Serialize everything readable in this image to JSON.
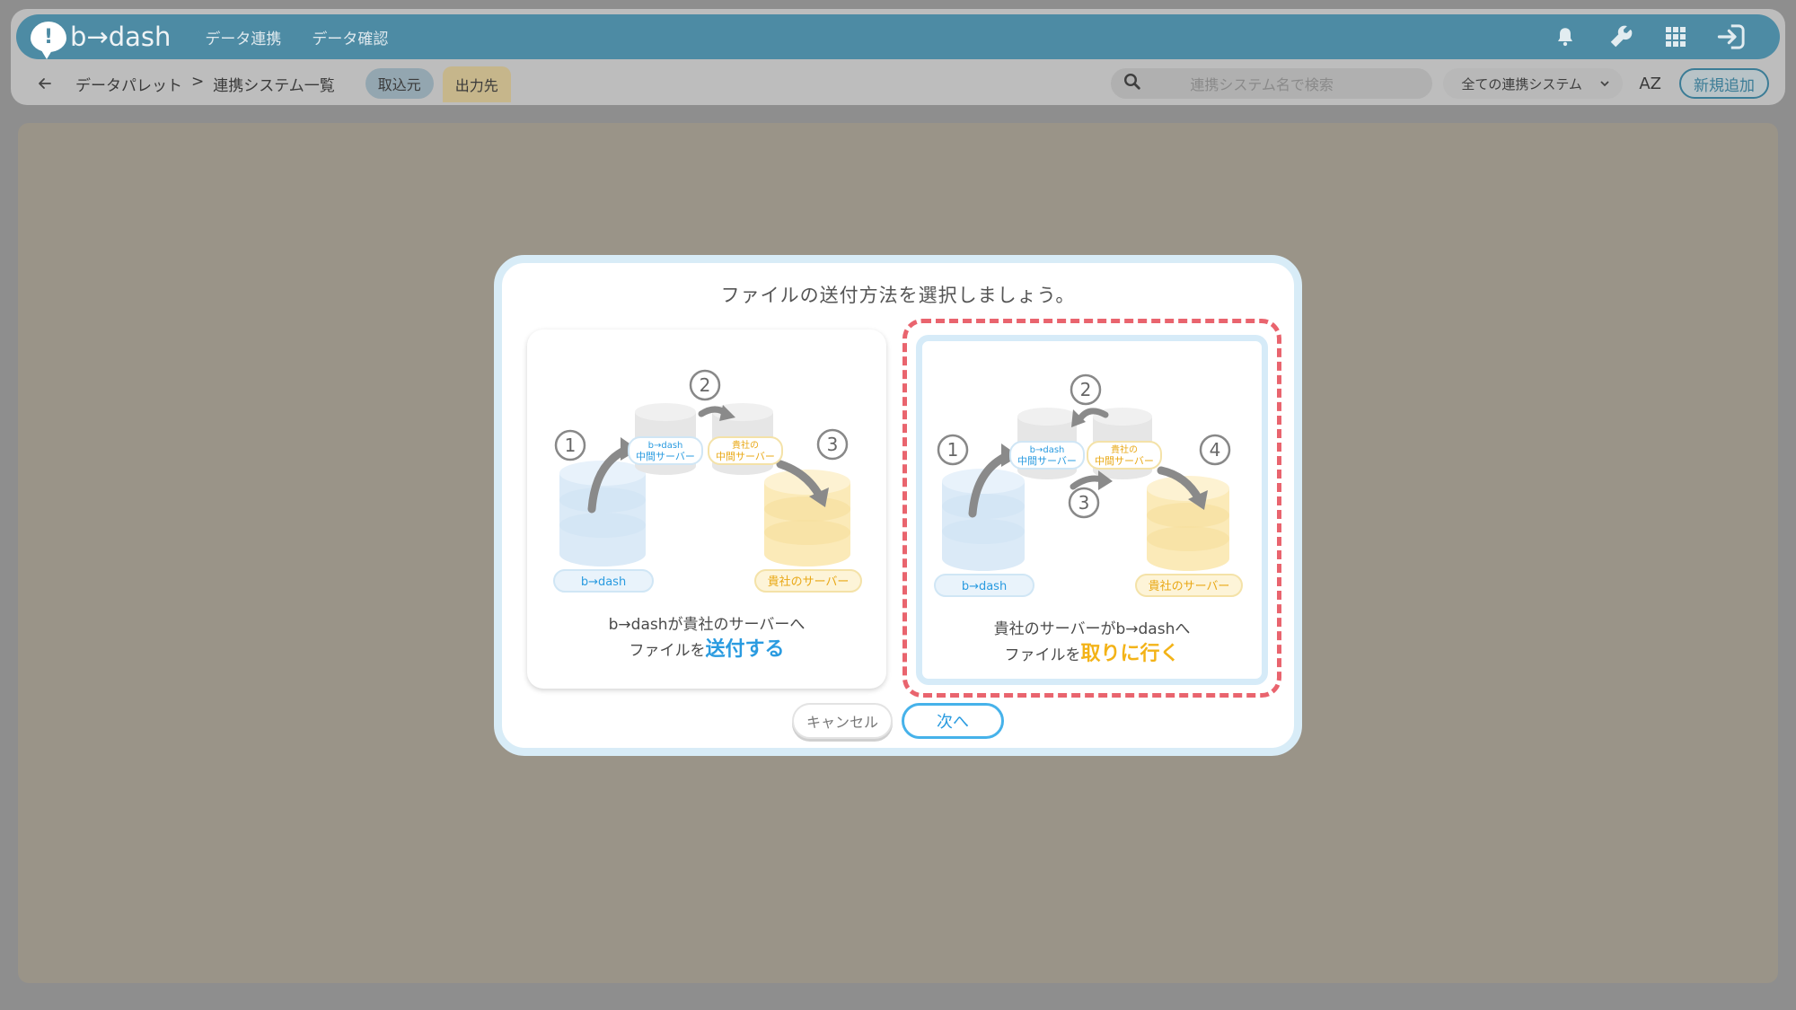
{
  "app": {
    "logo_text": "b→dash",
    "logo_mark": "!"
  },
  "topnav": {
    "items": [
      "データ連携",
      "データ確認"
    ]
  },
  "icons": [
    "bell-icon",
    "wrench-icon",
    "grid-icon",
    "logout-icon",
    "back-arrow-icon",
    "search-icon",
    "chevron-down-icon",
    "sort-az-icon"
  ],
  "subbar": {
    "breadcrumb_root": "データパレット",
    "breadcrumb_sep": ">",
    "breadcrumb_current": "連携システム一覧",
    "tab_source": "取込元",
    "tab_destination": "出力先",
    "search_placeholder": "連携システム名で検索",
    "filter_value": "全ての連携システム",
    "sort_label": "AZ",
    "new_button": "新規追加"
  },
  "modal": {
    "title": "ファイルの送付方法を選択しましょう。",
    "option_send": {
      "caption_line1": "b→dashが貴社のサーバーへ",
      "caption_line2_prefix": "ファイルを",
      "caption_line2_strong": "送付する",
      "steps": [
        "1",
        "2",
        "3"
      ],
      "label_source": "b→dash",
      "label_mid_left_1": "b→dash",
      "label_mid_left_2": "中間サーバー",
      "label_mid_right_1": "貴社の",
      "label_mid_right_2": "中間サーバー",
      "label_dest": "貴社のサーバー"
    },
    "option_fetch": {
      "caption_line1": "貴社のサーバーがb→dashへ",
      "caption_line2_prefix": "ファイルを",
      "caption_line2_strong": "取りに行く",
      "steps": [
        "1",
        "2",
        "3",
        "4"
      ],
      "label_source": "b→dash",
      "label_mid_left_1": "b→dash",
      "label_mid_left_2": "中間サーバー",
      "label_mid_right_1": "貴社の",
      "label_mid_right_2": "中間サーバー",
      "label_dest": "貴社のサーバー"
    },
    "cancel_button": "キャンセル",
    "next_button": "次へ"
  },
  "colors": {
    "header": "#4d8ba4",
    "overlay": "#9a9488",
    "highlight_dashed": "#e9646e",
    "accent_blue": "#2a9be0",
    "accent_yellow": "#f3b318"
  }
}
